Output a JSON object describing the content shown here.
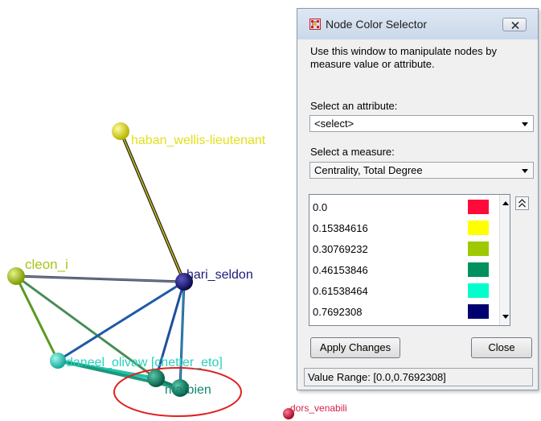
{
  "graph": {
    "nodes": [
      {
        "id": "harban",
        "label": "haban_wellis-lieutenant",
        "color": "#e3e01c",
        "label_color": "#e3e01c"
      },
      {
        "id": "cleon",
        "label": "cleon_i",
        "color": "#a7c51a",
        "label_color": "#a7c51a"
      },
      {
        "id": "hari",
        "label": "hari_seldon",
        "color": "#1e1a78",
        "label_color": "#1e1a78"
      },
      {
        "id": "daneel",
        "label": "daneel_olivaw [chetter_eto]",
        "color": "#26d2bd",
        "label_color": "#26d2bd"
      },
      {
        "id": "marbien",
        "label": "marbien",
        "color": "#13866c",
        "label_color": "#13866c"
      },
      {
        "id": "dors",
        "label": "dors_venabili",
        "color": "#d81f47",
        "label_color": "#d81f47"
      }
    ],
    "highlight_color": "#e02020"
  },
  "dialog": {
    "title": "Node Color Selector",
    "description": "Use this window to manipulate nodes by measure value or attribute.",
    "attribute_label": "Select an attribute:",
    "attribute_value": "<select>",
    "measure_label": "Select a measure:",
    "measure_value": "Centrality, Total Degree",
    "legend": [
      {
        "value": "0.0",
        "color": "#ff0a3a"
      },
      {
        "value": "0.15384616",
        "color": "#ffff00"
      },
      {
        "value": "0.30769232",
        "color": "#9ec800"
      },
      {
        "value": "0.46153846",
        "color": "#00915f"
      },
      {
        "value": "0.61538464",
        "color": "#00ffcc"
      },
      {
        "value": "0.7692308",
        "color": "#000070"
      }
    ],
    "apply_label": "Apply Changes",
    "close_label": "Close",
    "status": "Value Range: [0.0,0.7692308]"
  }
}
